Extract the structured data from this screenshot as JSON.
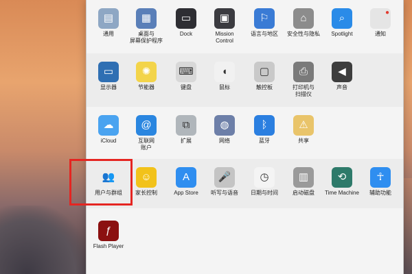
{
  "row1": [
    {
      "label": "通用",
      "icon": "general-icon"
    },
    {
      "label": "桌面与\n屏幕保护程序",
      "icon": "desktop-screensaver-icon"
    },
    {
      "label": "Dock",
      "icon": "dock-icon"
    },
    {
      "label": "Mission\nControl",
      "icon": "mission-control-icon"
    },
    {
      "label": "语言与地区",
      "icon": "language-region-icon"
    },
    {
      "label": "安全性与隐私",
      "icon": "security-privacy-icon"
    },
    {
      "label": "Spotlight",
      "icon": "spotlight-icon"
    },
    {
      "label": "通知",
      "icon": "notifications-icon"
    }
  ],
  "row2": [
    {
      "label": "显示器",
      "icon": "displays-icon"
    },
    {
      "label": "节能器",
      "icon": "energy-saver-icon"
    },
    {
      "label": "键盘",
      "icon": "keyboard-icon"
    },
    {
      "label": "鼠标",
      "icon": "mouse-icon"
    },
    {
      "label": "触控板",
      "icon": "trackpad-icon"
    },
    {
      "label": "打印机与\n扫描仪",
      "icon": "printers-scanners-icon"
    },
    {
      "label": "声音",
      "icon": "sound-icon"
    }
  ],
  "row3": [
    {
      "label": "iCloud",
      "icon": "icloud-icon"
    },
    {
      "label": "互联网\n账户",
      "icon": "internet-accounts-icon"
    },
    {
      "label": "扩展",
      "icon": "extensions-icon"
    },
    {
      "label": "网络",
      "icon": "network-icon"
    },
    {
      "label": "蓝牙",
      "icon": "bluetooth-icon"
    },
    {
      "label": "共享",
      "icon": "sharing-icon"
    }
  ],
  "row4": [
    {
      "label": "用户与群组",
      "icon": "users-groups-icon"
    },
    {
      "label": "家长控制",
      "icon": "parental-controls-icon"
    },
    {
      "label": "App Store",
      "icon": "app-store-icon"
    },
    {
      "label": "听写与语音",
      "icon": "dictation-speech-icon"
    },
    {
      "label": "日期与时间",
      "icon": "date-time-icon"
    },
    {
      "label": "启动磁盘",
      "icon": "startup-disk-icon"
    },
    {
      "label": "Time Machine",
      "icon": "time-machine-icon"
    },
    {
      "label": "辅助功能",
      "icon": "accessibility-icon"
    }
  ],
  "row5": [
    {
      "label": "Flash Player",
      "icon": "flash-player-icon"
    }
  ],
  "icon_glyphs": {
    "general-icon": "▤",
    "desktop-screensaver-icon": "▦",
    "dock-icon": "▭",
    "mission-control-icon": "▣",
    "language-region-icon": "⚐",
    "security-privacy-icon": "⌂",
    "spotlight-icon": "⌕",
    "notifications-icon": "●",
    "displays-icon": "▭",
    "energy-saver-icon": "✺",
    "keyboard-icon": "⌨",
    "mouse-icon": "◖",
    "trackpad-icon": "▢",
    "printers-scanners-icon": "⎙",
    "sound-icon": "◀",
    "icloud-icon": "☁",
    "internet-accounts-icon": "@",
    "extensions-icon": "⧉",
    "network-icon": "◍",
    "bluetooth-icon": "ᛒ",
    "sharing-icon": "⚠",
    "users-groups-icon": "👥",
    "parental-controls-icon": "☺",
    "app-store-icon": "A",
    "dictation-speech-icon": "🎤",
    "date-time-icon": "◷",
    "startup-disk-icon": "▥",
    "time-machine-icon": "⟲",
    "accessibility-icon": "☥",
    "flash-player-icon": "ƒ"
  },
  "icon_colors": {
    "general-icon": "#8ea7c4",
    "desktop-screensaver-icon": "#5a7fb8",
    "dock-icon": "#2e2e33",
    "mission-control-icon": "#3b3b40",
    "language-region-icon": "#3a7bd5",
    "security-privacy-icon": "#8c8c8c",
    "spotlight-icon": "#2a8be8",
    "notifications-icon": "#e5e5e5",
    "displays-icon": "#2f6fb3",
    "energy-saver-icon": "#f3d44a",
    "keyboard-icon": "#d8d8d8",
    "mouse-icon": "#f1f1f1",
    "trackpad-icon": "#c9c9c9",
    "printers-scanners-icon": "#7a7a7a",
    "sound-icon": "#3d3d3d",
    "icloud-icon": "#4aa3f0",
    "internet-accounts-icon": "#2a86e0",
    "extensions-icon": "#b0b6bb",
    "network-icon": "#6d7fa8",
    "bluetooth-icon": "#2b7fe0",
    "sharing-icon": "#e9c46a",
    "users-groups-icon": "#f2f2f2",
    "parental-controls-icon": "#f2c21a",
    "app-store-icon": "#2f8ef0",
    "dictation-speech-icon": "#c4c4c4",
    "date-time-icon": "#f4f4f4",
    "startup-disk-icon": "#9a9a9a",
    "time-machine-icon": "#2e7a6a",
    "accessibility-icon": "#2f8ef0",
    "flash-player-icon": "#8b1010"
  }
}
